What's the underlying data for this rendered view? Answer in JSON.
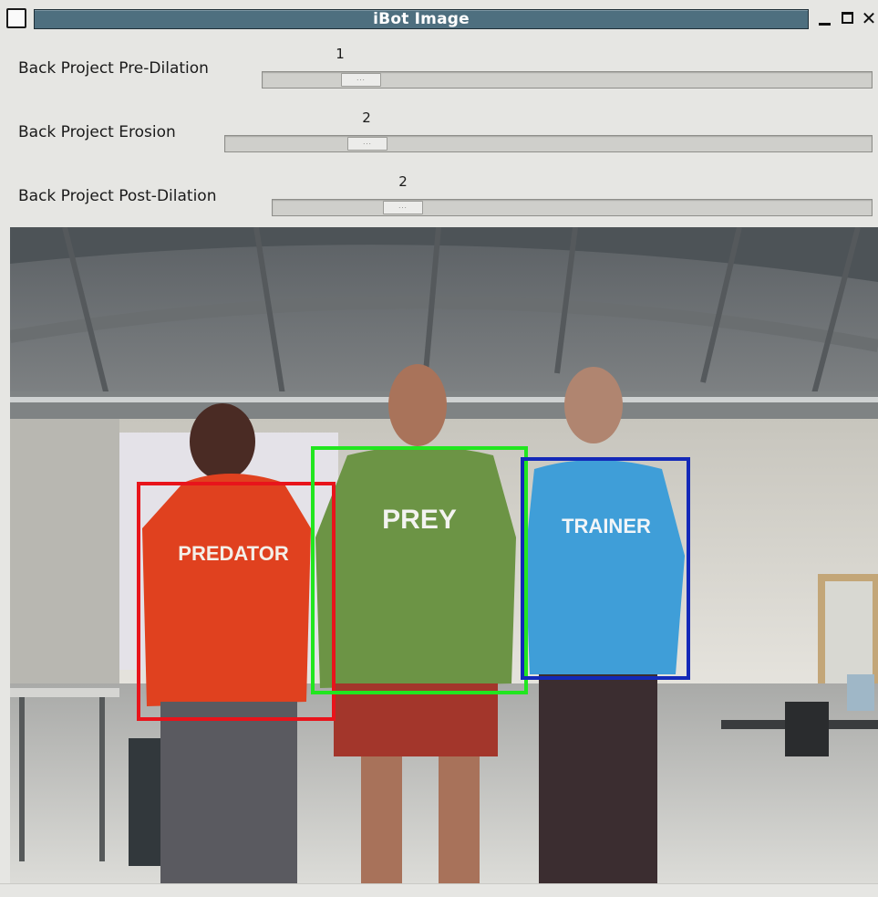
{
  "window": {
    "title": "iBot Image",
    "menu_icon": "window-menu-icon",
    "buttons": {
      "minimize": "minimize-icon",
      "maximize": "maximize-icon",
      "close": "close-icon"
    },
    "close_glyph": "✕"
  },
  "sliders": [
    {
      "label": "Back Project Pre-Dilation",
      "value": "1",
      "level": 0.138
    },
    {
      "label": "Back Project Erosion",
      "value": "2",
      "level": 0.202
    },
    {
      "label": "Back Project Post-Dilation",
      "value": "2",
      "level": 0.198
    }
  ],
  "image": {
    "boxes": [
      {
        "label": "PREDATOR",
        "color": "#e8141b"
      },
      {
        "label": "PREY",
        "color": "#21e61f"
      },
      {
        "label": "TRAINER",
        "color": "#1429b8"
      }
    ]
  },
  "colors": {
    "titlebar": "#4e6f7f",
    "window_bg": "#e6e6e3",
    "predator_shirt": "#e0411f",
    "prey_shirt": "#6c9445",
    "trainer_shirt": "#3f9ed8"
  }
}
